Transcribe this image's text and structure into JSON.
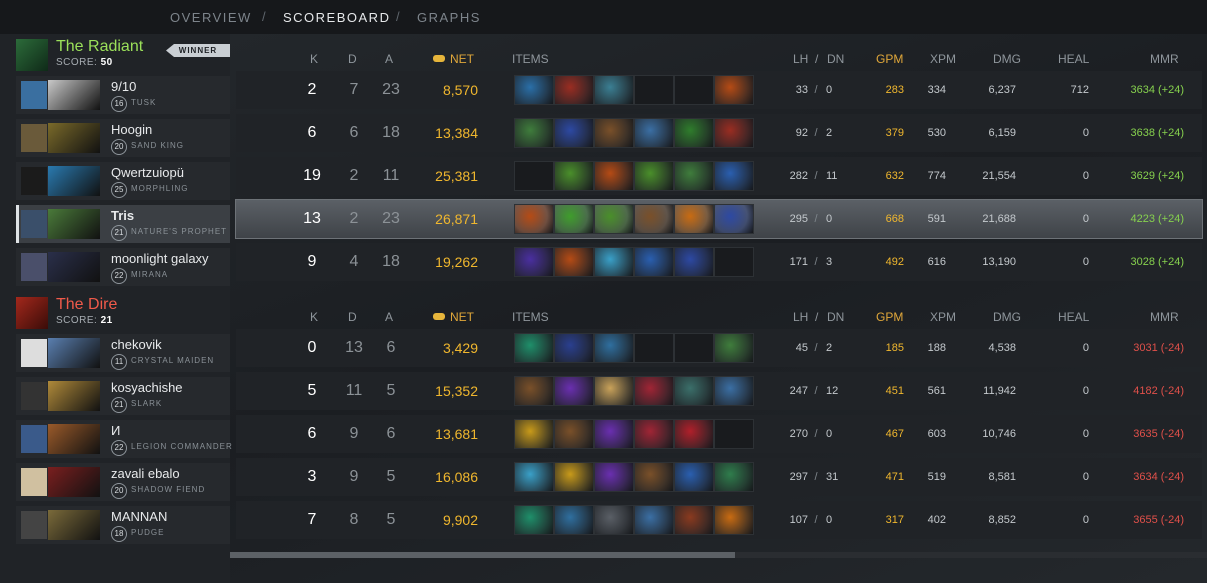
{
  "nav": {
    "tabs": [
      "OVERVIEW",
      "SCOREBOARD",
      "GRAPHS"
    ],
    "active": 1,
    "separator": "/"
  },
  "headers": {
    "k": "K",
    "d": "D",
    "a": "A",
    "net": "NET",
    "items": "ITEMS",
    "lh": "LH",
    "slash": "/",
    "dn": "DN",
    "gpm": "GPM",
    "xpm": "XPM",
    "dmg": "DMG",
    "heal": "HEAL",
    "mmr": "MMR"
  },
  "radiant": {
    "name": "The Radiant",
    "score_label": "SCORE:",
    "score": "50",
    "badge": "WINNER",
    "players": [
      {
        "name": "9/10",
        "hero": "TUSK",
        "level": "16",
        "k": "2",
        "d": "7",
        "a": "23",
        "net": "8,570",
        "lh": "33",
        "dn": "0",
        "gpm": "283",
        "xpm": "334",
        "dmg": "6,237",
        "heal": "712",
        "mmr": "3634 (+24)",
        "items": [
          "#2a6fa8",
          "#9a2d22",
          "#3b7f93",
          "",
          "",
          "#b54b15"
        ]
      },
      {
        "name": "Hoogin",
        "hero": "SAND KING",
        "level": "20",
        "k": "6",
        "d": "6",
        "a": "18",
        "net": "13,384",
        "lh": "92",
        "dn": "2",
        "gpm": "379",
        "xpm": "530",
        "dmg": "6,159",
        "heal": "0",
        "mmr": "3638 (+24)",
        "items": [
          "#3f7d3c",
          "#2d49a3",
          "#7a5029",
          "#3b6fa4",
          "#2f7d2c",
          "#9a2d22"
        ]
      },
      {
        "name": "Qwertzuiopü",
        "hero": "MORPHLING",
        "level": "25",
        "k": "19",
        "d": "2",
        "a": "11",
        "net": "25,381",
        "lh": "282",
        "dn": "11",
        "gpm": "632",
        "xpm": "774",
        "dmg": "21,554",
        "heal": "0",
        "mmr": "3629 (+24)",
        "items": [
          "",
          "#4a8f2a",
          "#b54b15",
          "#4a8f2a",
          "#3f7d3c",
          "#2a5fb0",
          "#7a5029"
        ]
      },
      {
        "name": "Tris",
        "hero": "NATURE'S PROPHET",
        "level": "21",
        "k": "13",
        "d": "2",
        "a": "23",
        "net": "26,871",
        "lh": "295",
        "dn": "0",
        "gpm": "668",
        "xpm": "591",
        "dmg": "21,688",
        "heal": "0",
        "mmr": "4223 (+24)",
        "items": [
          "#b54b15",
          "#3f9d2c",
          "#4a8f2a",
          "#7a5029",
          "#c86b12",
          "#2d49a3"
        ]
      },
      {
        "name": "moonlight galaxy",
        "hero": "MIRANA",
        "level": "22",
        "k": "9",
        "d": "4",
        "a": "18",
        "net": "19,262",
        "lh": "171",
        "dn": "3",
        "gpm": "492",
        "xpm": "616",
        "dmg": "13,190",
        "heal": "0",
        "mmr": "3028 (+24)",
        "items": [
          "#4a2fa0",
          "#b54b15",
          "#3aa0c8",
          "#2a5fb0",
          "#2d49a3",
          ""
        ]
      }
    ]
  },
  "dire": {
    "name": "The Dire",
    "score_label": "SCORE:",
    "score": "21",
    "players": [
      {
        "name": "chekovik",
        "hero": "CRYSTAL MAIDEN",
        "level": "11",
        "k": "0",
        "d": "13",
        "a": "6",
        "net": "3,429",
        "lh": "45",
        "dn": "2",
        "gpm": "185",
        "xpm": "188",
        "dmg": "4,538",
        "heal": "0",
        "mmr": "3031 (-24)",
        "items": [
          "#1f8f6a",
          "#2a3f8f",
          "#2f6f9f",
          "",
          "",
          "#3f7d3c"
        ]
      },
      {
        "name": "kosyachishe",
        "hero": "SLARK",
        "level": "21",
        "k": "5",
        "d": "11",
        "a": "5",
        "net": "15,352",
        "lh": "247",
        "dn": "12",
        "gpm": "451",
        "xpm": "561",
        "dmg": "11,942",
        "heal": "0",
        "mmr": "4182 (-24)",
        "items": [
          "#7a5029",
          "#6a2fb0",
          "#c9a25a",
          "#a02535",
          "#3b6f6a",
          "#3b6fa4"
        ]
      },
      {
        "name": "И",
        "hero": "LEGION COMMANDER",
        "level": "22",
        "k": "6",
        "d": "9",
        "a": "6",
        "net": "13,681",
        "lh": "270",
        "dn": "0",
        "gpm": "467",
        "xpm": "603",
        "dmg": "10,746",
        "heal": "0",
        "mmr": "3635 (-24)",
        "items": [
          "#c89a1a",
          "#7a5029",
          "#6a2fb0",
          "#a02535",
          "#b0202a",
          ""
        ]
      },
      {
        "name": "zavali ebalo",
        "hero": "SHADOW FIEND",
        "level": "20",
        "k": "3",
        "d": "9",
        "a": "5",
        "net": "16,086",
        "lh": "297",
        "dn": "31",
        "gpm": "471",
        "xpm": "519",
        "dmg": "8,581",
        "heal": "0",
        "mmr": "3634 (-24)",
        "items": [
          "#3aa0c8",
          "#c89a1a",
          "#6a2fb0",
          "#7a5029",
          "#2a5fb0",
          "#2f7d4c"
        ]
      },
      {
        "name": "MANNAN",
        "hero": "PUDGE",
        "level": "18",
        "k": "7",
        "d": "8",
        "a": "5",
        "net": "9,902",
        "lh": "107",
        "dn": "0",
        "gpm": "317",
        "xpm": "402",
        "dmg": "8,852",
        "heal": "0",
        "mmr": "3655 (-24)",
        "items": [
          "#1f8f6a",
          "#2f6f9f",
          "#5a5f66",
          "#3b6fa4",
          "#8a3a1f",
          "#c86b12"
        ]
      }
    ]
  },
  "colors": {
    "gold": "#f0b72e",
    "mmr_up": "#86d14e",
    "mmr_down": "#e0504a",
    "radiant_name": "#9be05a",
    "dire_name": "#f05a4a"
  }
}
